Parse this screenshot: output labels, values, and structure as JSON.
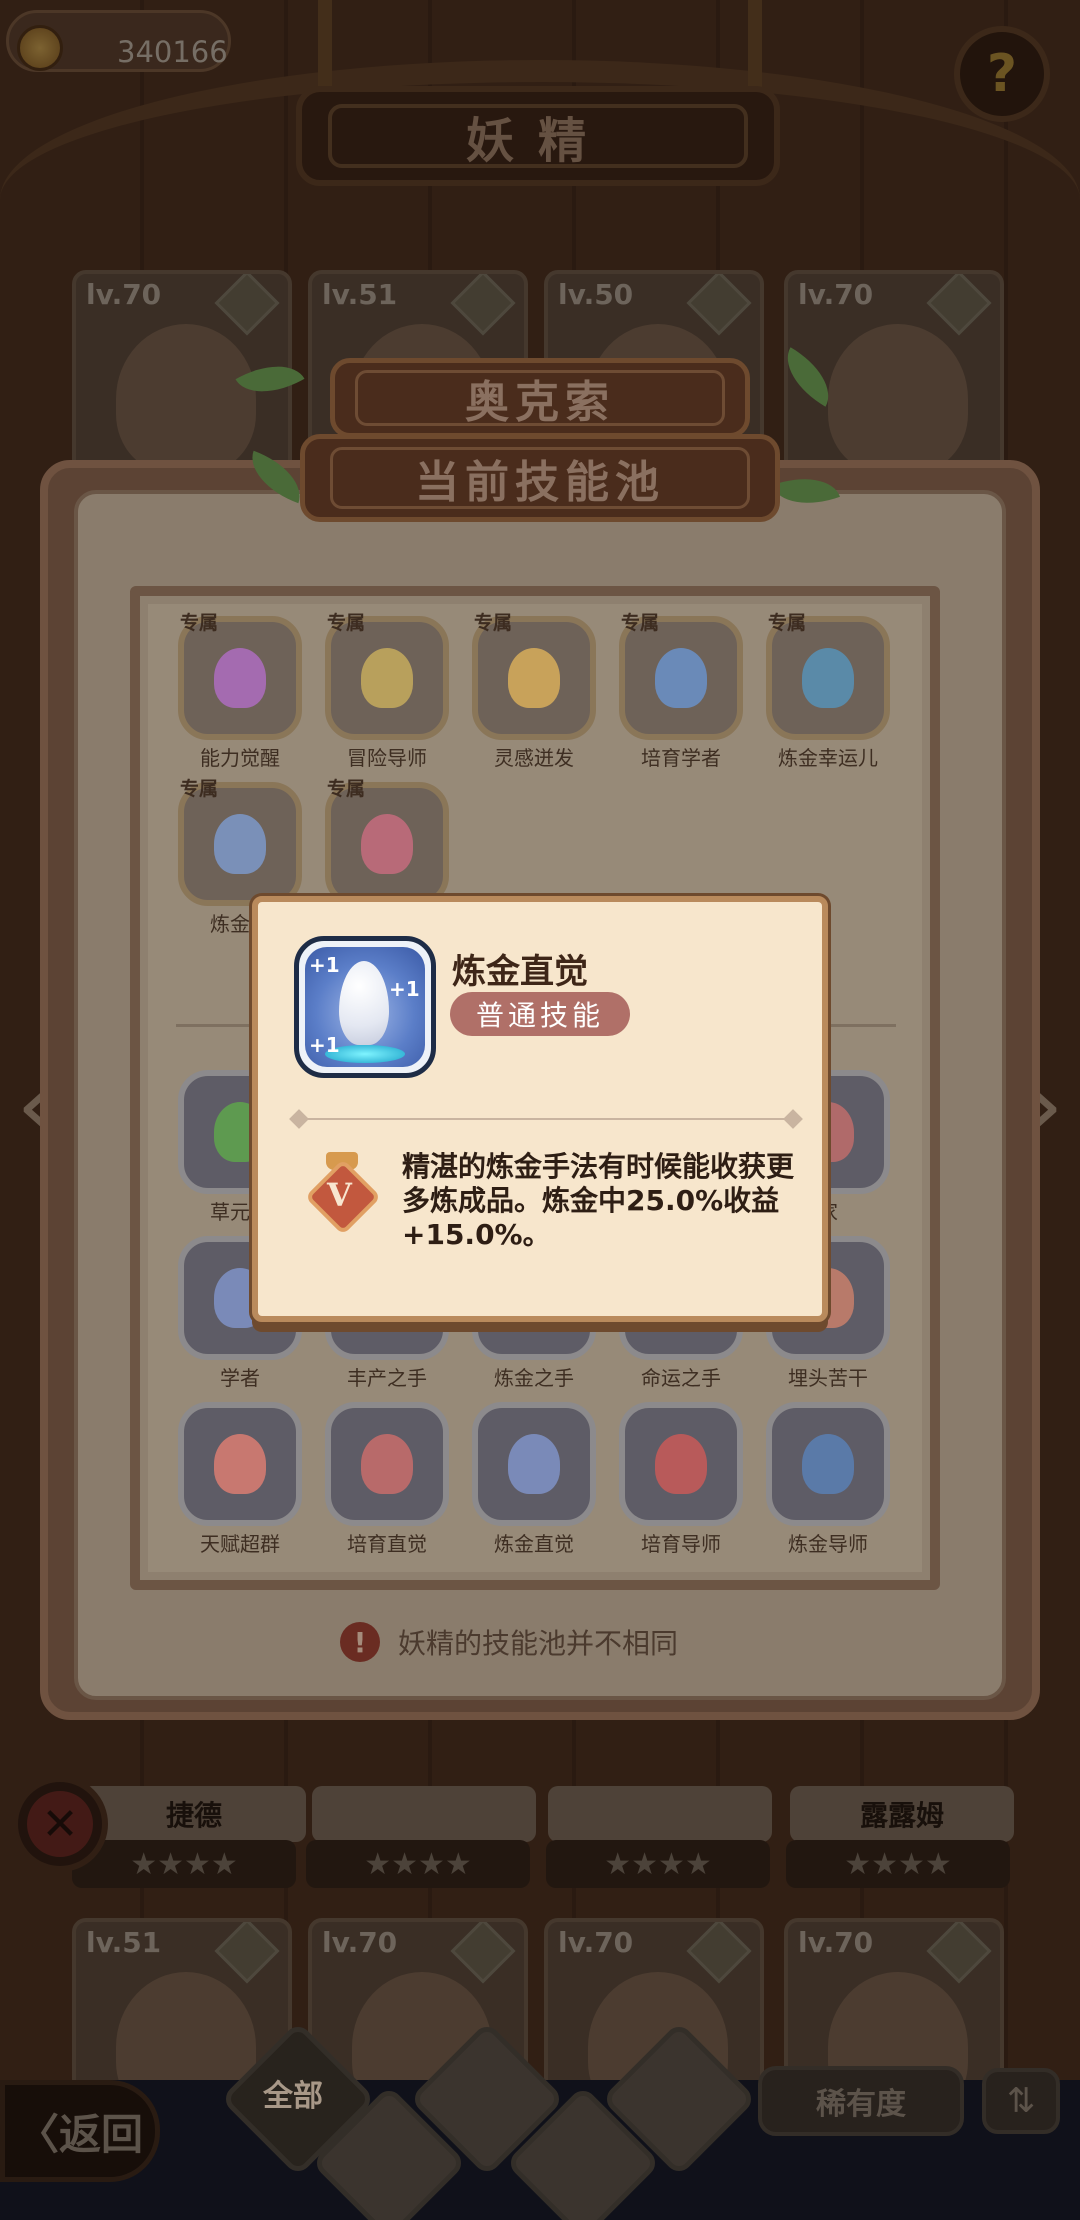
{
  "hud": {
    "coins": "340166",
    "help_label": "?"
  },
  "header": {
    "title": "妖精"
  },
  "heroes_top": [
    {
      "level": "lv.70"
    },
    {
      "level": "lv.51"
    },
    {
      "level": "lv.50"
    },
    {
      "level": "lv.70"
    }
  ],
  "heroes_middle": [
    {
      "name": "捷德",
      "stars": "★★★★"
    },
    {
      "name": "",
      "stars": "★★★★"
    },
    {
      "name": "",
      "stars": "★★★★"
    },
    {
      "name": "露露姆",
      "stars": "★★★★"
    }
  ],
  "heroes_bottom": [
    {
      "level": "lv.51"
    },
    {
      "level": "lv.70"
    },
    {
      "level": "lv.70"
    },
    {
      "level": "lv.70"
    }
  ],
  "skill_pool": {
    "hero_name": "奥克索",
    "title": "当前技能池",
    "exclusive_tag": "专属",
    "exclusive_skills": [
      {
        "label": "能力觉醒",
        "color": "#a46bb0"
      },
      {
        "label": "冒险导师",
        "color": "#b8a05c"
      },
      {
        "label": "灵感迸发",
        "color": "#c8a25a"
      },
      {
        "label": "培育学者",
        "color": "#6a8ab8"
      },
      {
        "label": "炼金幸运儿",
        "color": "#5a8aa8"
      },
      {
        "label": "炼金大",
        "color": "#7a90b8"
      },
      {
        "label": "",
        "color": "#b86a78"
      }
    ],
    "common_skills_row1": [
      {
        "label": "草元素",
        "color": "#5e9a50"
      },
      {
        "label": "",
        "color": "#7a7470"
      },
      {
        "label": "",
        "color": "#7a7470"
      },
      {
        "label": "",
        "color": "#7a7470"
      },
      {
        "label": "家",
        "color": "#b06a6a"
      }
    ],
    "common_skills_row2": [
      {
        "label": "学者",
        "color": "#7a8ab8"
      },
      {
        "label": "丰产之手",
        "color": "#a87a6a"
      },
      {
        "label": "炼金之手",
        "color": "#7a8aa8"
      },
      {
        "label": "命运之手",
        "color": "#a8a070"
      },
      {
        "label": "埋头苦干",
        "color": "#b87a6a"
      }
    ],
    "common_skills_row3": [
      {
        "label": "天赋超群",
        "color": "#c87870"
      },
      {
        "label": "培育直觉",
        "color": "#b86a6a"
      },
      {
        "label": "炼金直觉",
        "color": "#7a8ab8"
      },
      {
        "label": "培育导师",
        "color": "#b85a5a"
      },
      {
        "label": "炼金导师",
        "color": "#5a7aa8"
      }
    ],
    "note": "妖精的技能池并不相同",
    "note_icon": "!"
  },
  "popup": {
    "skill_name": "炼金直觉",
    "skill_type": "普通技能",
    "badge_letter": "V",
    "description": "精湛的炼金手法有时候能收获更多炼成品。炼金中25.0%收益+15.0%。",
    "plus_marks": [
      "+1",
      "+1",
      "+1"
    ]
  },
  "bottom_bar": {
    "back_label": "〈返回",
    "filter_all_label": "全部",
    "rarity_label": "稀有度",
    "sort_icon": "sort-icon"
  },
  "close_label": "✕"
}
